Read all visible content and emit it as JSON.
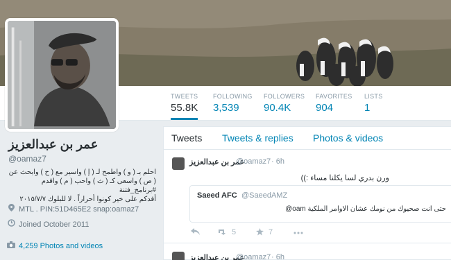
{
  "profile": {
    "name": "عمر بن عبدالعزيز",
    "handle": "@oamaz7",
    "bio_line1": "احلم بـ ( و ) واطمح لـ ( إ ) واسير مع ( ح ) وابحث عن",
    "bio_line2": "( ص ) واسعى كـ ( ث ) واحب ( م ) واقدم #برنامج_فتنة",
    "bio_line3": "أقدكم على خير كونوا أحراراً . لا للبلوك ٢٠١٥/٧/٧",
    "location": "MTL . PIN:51D465E2 snap:oamaz7",
    "joined": "Joined October 2011",
    "photos": "4,259 Photos and videos",
    "location_icon": "map-pin-icon",
    "joined_icon": "calendar-icon",
    "photos_icon": "camera-icon"
  },
  "stats": [
    {
      "label": "TWEETS",
      "value": "55.8K"
    },
    {
      "label": "FOLLOWING",
      "value": "3,539"
    },
    {
      "label": "FOLLOWERS",
      "value": "90.4K"
    },
    {
      "label": "FAVORITES",
      "value": "904"
    },
    {
      "label": "LISTS",
      "value": "1"
    }
  ],
  "tabs": [
    "Tweets",
    "Tweets & replies",
    "Photos & videos"
  ],
  "tweets": [
    {
      "name": "عمر بن عبدالعزيز",
      "handle": "@oamaz7",
      "time": "· 6h",
      "text": "ورن بدري لسا يكلنا مساء :))",
      "quote": {
        "name": "Saeed AFC",
        "handle": "@SaeedAMZ",
        "text": "@oam حتى انت صحيوك من نومك عشان الاوامر الملكية"
      },
      "retweets": "5",
      "favorites": "7"
    },
    {
      "name": "عمر بن عبدالعزيز",
      "handle": "@oamaz7",
      "time": "· 6h"
    }
  ],
  "colors": {
    "link": "#0084b4",
    "text": "#292f33",
    "muted": "#8899a6"
  }
}
